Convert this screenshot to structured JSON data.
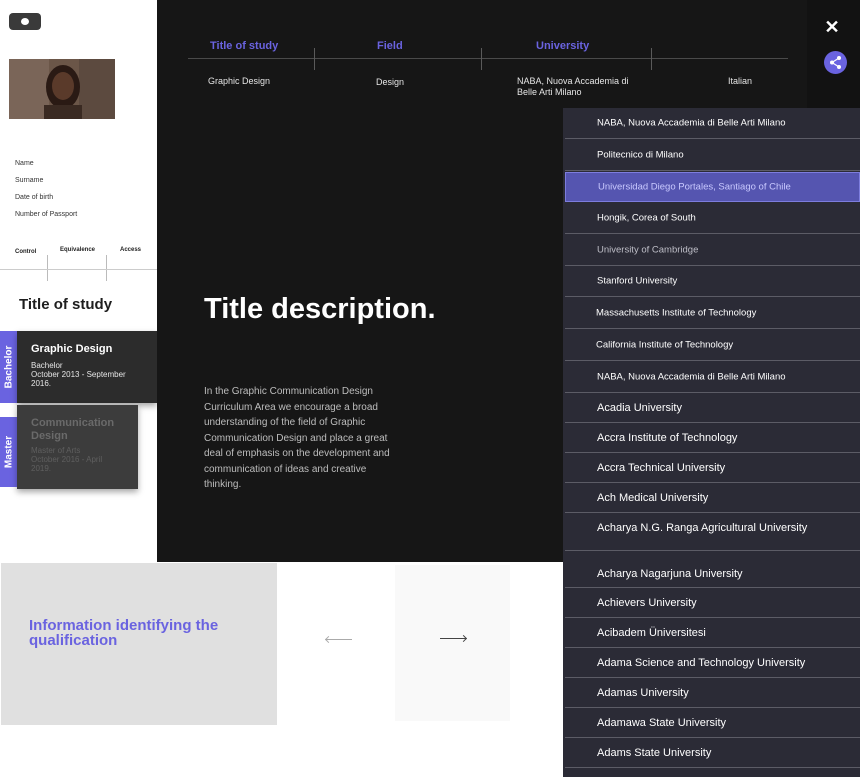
{
  "profile": {
    "fields": [
      "Name",
      "Surname",
      "Date of birth",
      "Number of Passport"
    ],
    "tabs": [
      "Control",
      "Equivalence",
      "Access"
    ]
  },
  "study": {
    "heading": "Title of study",
    "cards": [
      {
        "side": "Bachelor",
        "title": "Graphic Design",
        "subtitle": "Bachelor",
        "dates": "October 2013 - September 2016."
      },
      {
        "side": "Master",
        "title": "Communication Design",
        "subtitle": "Master of Arts",
        "dates": "October 2016 - April 2019."
      }
    ]
  },
  "table": {
    "headers": [
      "Title of study",
      "Field",
      "University"
    ],
    "row": [
      "Graphic Design",
      "Design",
      "NABA, Nuova Accademia di Belle Arti Milano",
      "Italian"
    ]
  },
  "detail": {
    "title": "Title description.",
    "body": "In the Graphic Communication Design Curriculum Area we encourage a broad understanding of the field of Graphic Communication Design and place a great deal of emphasis on the development and communication of ideas and creative thinking."
  },
  "info": {
    "heading": "Information identifying the qualification"
  },
  "universities": [
    "NABA, Nuova Accademia di Belle Arti Milano",
    "Politecnico di Milano",
    "Universidad Diego Portales, Santiago of Chile",
    "Hongik, Corea of South",
    "University of Cambridge",
    "Stanford University",
    "Massachusetts Institute of Technology",
    "California Institute of Technology",
    "NABA, Nuova Accademia di Belle Arti Milano",
    "Acadia University",
    "Accra Institute of Technology",
    "Accra Technical University",
    "Ach Medical University",
    "Acharya N.G. Ranga Agricultural University",
    "",
    "Acharya Nagarjuna University",
    "Achievers University",
    "Acibadem Üniversitesi",
    "Adama Science and Technology University",
    "Adamas University",
    "Adamawa State University",
    "Adams State University"
  ],
  "selected_university": "Universidad Diego Portales, Santiago of Chile",
  "icons": {
    "close": "close-icon",
    "share": "share-icon",
    "toggle": "toggle-icon"
  },
  "colors": {
    "accent": "#6a63e0",
    "dark": "#161616",
    "list_bg": "#2b2b36",
    "selected": "#5555b0"
  }
}
